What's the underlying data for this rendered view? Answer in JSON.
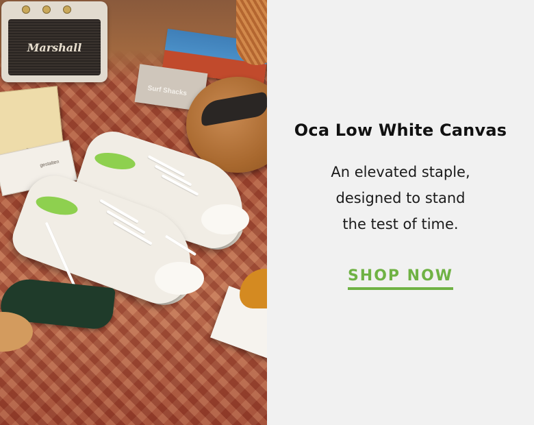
{
  "banner": {
    "image": {
      "speaker_brand": "Marshall",
      "book_surf_label": "Surf Shacks",
      "book_label": "gestalten",
      "fin_label": "WAW"
    },
    "product_title": "Oca Low White Canvas",
    "tagline_lines": [
      "An elevated staple,",
      "designed to stand",
      "the test of time."
    ],
    "cta": {
      "label": "SHOP NOW"
    },
    "colors": {
      "accent": "#6fb244",
      "panel_background": "#f1f1f1",
      "title_text": "#111111"
    }
  }
}
